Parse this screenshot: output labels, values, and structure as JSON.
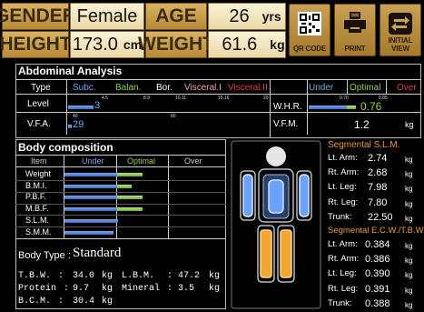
{
  "header": {
    "gender_label": "GENDER",
    "gender_value": "Female",
    "age_label": "AGE",
    "age_value": "26",
    "age_unit": "yrs",
    "height_label": "HEIGHT",
    "height_value": "173.0",
    "height_unit": "cm",
    "weight_label": "WEIGHT",
    "weight_value": "61.6",
    "weight_unit": "kg",
    "qr_label": "QR CODE",
    "print_label": "PRINT",
    "initial_label": "INITIAL VIEW"
  },
  "abdominal": {
    "title": "Abdominal Analysis",
    "cols": {
      "type": "Type",
      "subc": "Subc.",
      "balan": "Balan.",
      "bor": "Bor.",
      "visceral1": "Visceral.I",
      "visceral2": "Visceral.II"
    },
    "level_label": "Level",
    "level_value": "3",
    "level_ticks": [
      "4.5",
      "8.9",
      "10.11",
      "15.16",
      "20"
    ],
    "vfa_label": "V.F.A.",
    "vfa_value": "29",
    "vfa_ticks": [
      "40",
      "80"
    ],
    "right_cols": {
      "under": "Under",
      "optimal": "Optimal",
      "over": "Over"
    },
    "whr_label": "W.H.R.",
    "whr_value": "0.76",
    "whr_ticks": [
      "0.70",
      "0.85"
    ],
    "vfm_label": "V.F.M.",
    "vfm_value": "1.2",
    "vfm_unit": "kg"
  },
  "body_comp": {
    "title": "Body composition",
    "cols": {
      "item": "Item",
      "under": "Under",
      "optimal": "Optimal",
      "over": "Over"
    },
    "rows": [
      {
        "label": "Weight",
        "blue": 0.36,
        "green": 0.18
      },
      {
        "label": "B.M.I.",
        "blue": 0.36,
        "green": 0.1
      },
      {
        "label": "P.B.F.",
        "blue": 0.36,
        "green": 0.18
      },
      {
        "label": "M.B.F.",
        "blue": 0.36,
        "green": 0.18
      },
      {
        "label": "S.L.M.",
        "blue": 0.37,
        "green": 0
      },
      {
        "label": "S.M.M.",
        "blue": 0.34,
        "green": 0
      }
    ],
    "body_type_label": "Body Type :",
    "body_type_value": "Standard",
    "tbw_label": "T.B.W.",
    "tbw_value": "34.0",
    "tbw_unit": "kg",
    "lbm_label": "L.B.M.",
    "lbm_value": "47.2",
    "lbm_unit": "kg",
    "protein_label": "Protein",
    "protein_value": "9.7",
    "protein_unit": "kg",
    "mineral_label": "Mineral",
    "mineral_value": "3.5",
    "mineral_unit": "kg",
    "bcm_label": "B.C.M.",
    "bcm_value": "30.4",
    "bcm_unit": "kg"
  },
  "segmental": {
    "slm_title": "Segmental S.L.M.",
    "slm": [
      {
        "label": "Lt. Arm:",
        "value": "2.74",
        "unit": "kg"
      },
      {
        "label": "Rt. Arm:",
        "value": "2.68",
        "unit": "kg"
      },
      {
        "label": "Lt. Leg:",
        "value": "7.98",
        "unit": "kg"
      },
      {
        "label": "Rt. Leg:",
        "value": "7.80",
        "unit": "kg"
      },
      {
        "label": "Trunk:",
        "value": "22.50",
        "unit": "kg"
      }
    ],
    "ecw_title": "Segmental E.C.W./T.B.W.",
    "ecw": [
      {
        "label": "Lt. Arm:",
        "value": "0.384",
        "unit": "kg"
      },
      {
        "label": "Rt. Arm:",
        "value": "0.386",
        "unit": "kg"
      },
      {
        "label": "Lt. Leg:",
        "value": "0.390",
        "unit": "kg"
      },
      {
        "label": "Rt. Leg:",
        "value": "0.391",
        "unit": "kg"
      },
      {
        "label": "Trunk:",
        "value": "0.388",
        "unit": "kg"
      }
    ]
  },
  "colors": {
    "accent": "#c89a48",
    "blue": "#4a7fd4",
    "green": "#7fc24a",
    "orange": "#f09a3a",
    "red": "#e04040"
  }
}
